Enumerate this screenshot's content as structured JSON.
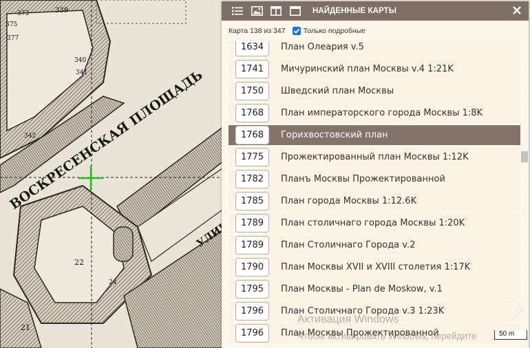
{
  "panel": {
    "title": "НАЙДЕННЫЕ КАРТЫ",
    "counter": "Карта 138 из 347",
    "detailed_only_label": "Только подробные",
    "detailed_only_checked": true
  },
  "maps": [
    {
      "year": "1634",
      "name": "План Олеария v.5"
    },
    {
      "year": "1741",
      "name": "Мичуринский план Москвы v.4 1:21K"
    },
    {
      "year": "1750",
      "name": "Шведский план Москвы"
    },
    {
      "year": "1768",
      "name": "План императорского города Москвы 1:8K"
    },
    {
      "year": "1768",
      "name": "Горихвостовский план",
      "selected": true
    },
    {
      "year": "1775",
      "name": "Прожектированный план Москвы 1:12K"
    },
    {
      "year": "1782",
      "name": "Планъ Москвы Прожектированной"
    },
    {
      "year": "1785",
      "name": "План города Москвы 1:12.6K"
    },
    {
      "year": "1789",
      "name": "План столичнаго города Москвы 1:20K"
    },
    {
      "year": "1789",
      "name": "План Столичнаго Города v.2"
    },
    {
      "year": "1790",
      "name": "План Москвы XVII и XVIII столетия 1:17K"
    },
    {
      "year": "1795",
      "name": "План Москвы - Plan de Moskow, v.1"
    },
    {
      "year": "1796",
      "name": "План Столичнаго Города v.3 1:23K"
    },
    {
      "year": "1796",
      "name": "План Москвы Прожектированной"
    }
  ],
  "map_labels": {
    "square": "ВОСКРЕСЕНСКАЯ ПЛОЩАДЬ",
    "street": "УЛИЦА",
    "numbers": [
      "373",
      "339",
      "375",
      "377",
      "340",
      "341",
      "342",
      "22",
      "21",
      "24"
    ]
  },
  "scale_label": "50 m",
  "watermark": {
    "line1": "Активация Windows",
    "line2": "Чтобы активировать Windows, перейдите"
  },
  "colors": {
    "header": "#7f6e64",
    "selected_row": "#857268",
    "row_bg": "#fbf3e2",
    "panel_bg": "#fdf7e9",
    "checkbox": "#1a73e8"
  }
}
